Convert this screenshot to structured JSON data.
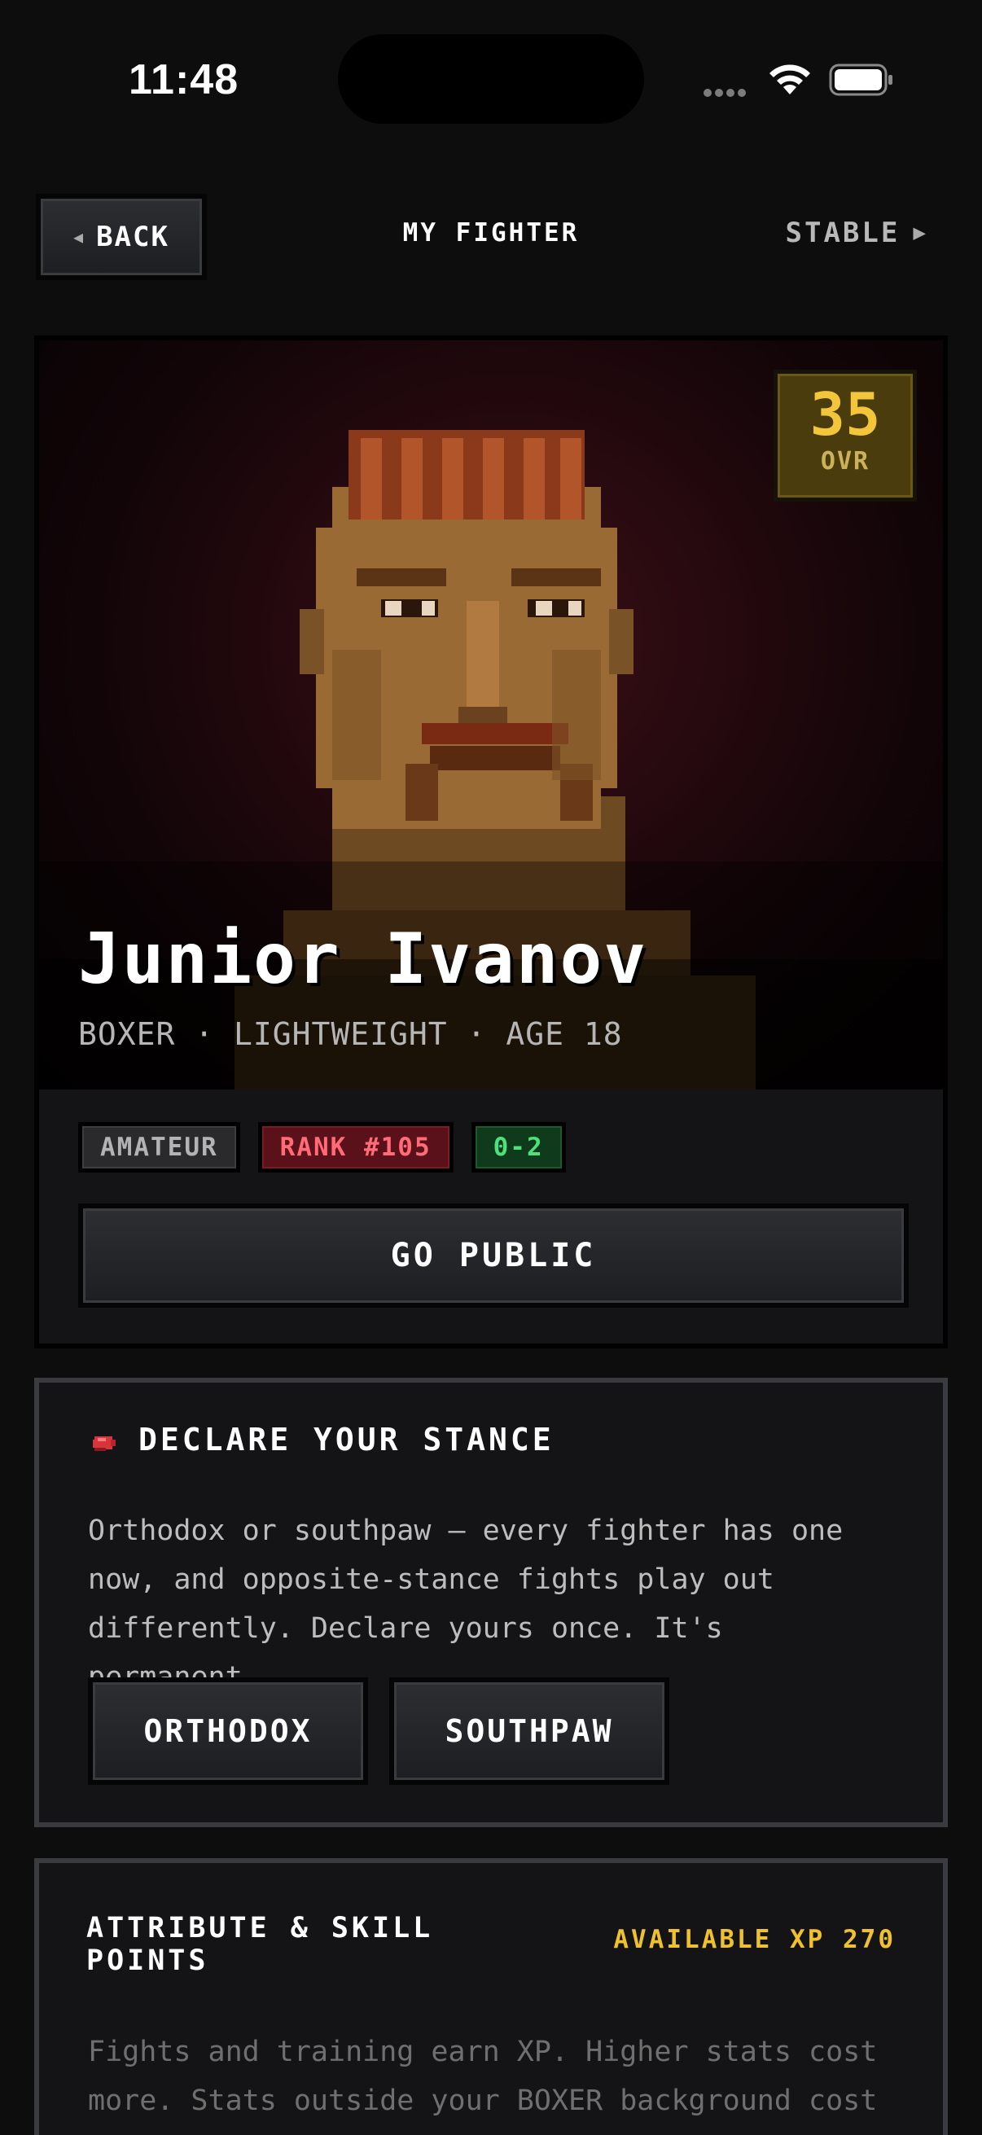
{
  "status_bar": {
    "time": "11:48"
  },
  "nav": {
    "back_label": "BACK",
    "title": "MY FIGHTER",
    "stable_label": "STABLE"
  },
  "fighter": {
    "name": "Junior Ivanov",
    "meta": "BOXER · LIGHTWEIGHT · AGE 18",
    "ovr_value": "35",
    "ovr_label": "OVR",
    "badges": {
      "level": "AMATEUR",
      "rank": "RANK #105",
      "record": "0-2"
    },
    "go_public_label": "GO PUBLIC"
  },
  "stance": {
    "title": "DECLARE YOUR STANCE",
    "icon": "boxing-glove-icon",
    "description": "Orthodox or southpaw — every fighter has one now, and opposite-stance fights play out differently. Declare yours once. It's permanent.",
    "options": [
      "ORTHODOX",
      "SOUTHPAW"
    ]
  },
  "attributes": {
    "title": "ATTRIBUTE & SKILL POINTS",
    "available_xp": "AVAILABLE XP 270",
    "description": "Fights and training earn XP. Higher stats cost more. Stats outside your BOXER background cost"
  },
  "colors": {
    "background": "#0d0d0e",
    "card": "#141416",
    "ovr_gold": "#f3c53a",
    "rank_red": "#ff6b76",
    "record_green": "#4ee07a",
    "xp_yellow": "#f0c12e"
  }
}
